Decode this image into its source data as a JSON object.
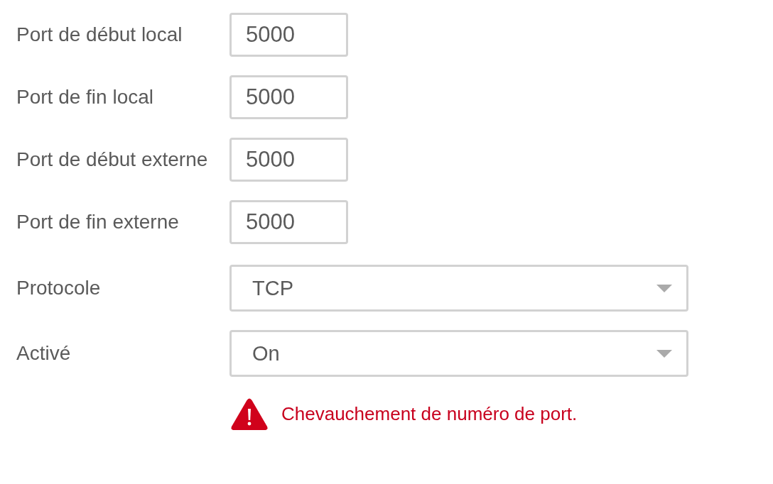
{
  "fields": [
    {
      "kind": "text",
      "label": "Port de début local",
      "value": "5000"
    },
    {
      "kind": "text",
      "label": "Port de fin local",
      "value": "5000"
    },
    {
      "kind": "text",
      "label": "Port de début externe",
      "value": "5000"
    },
    {
      "kind": "text",
      "label": "Port de fin externe",
      "value": "5000"
    },
    {
      "kind": "select",
      "label": "Protocole",
      "value": "TCP"
    },
    {
      "kind": "select",
      "label": "Activé",
      "value": "On"
    }
  ],
  "error": {
    "message": "Chevauchement de numéro de port."
  }
}
